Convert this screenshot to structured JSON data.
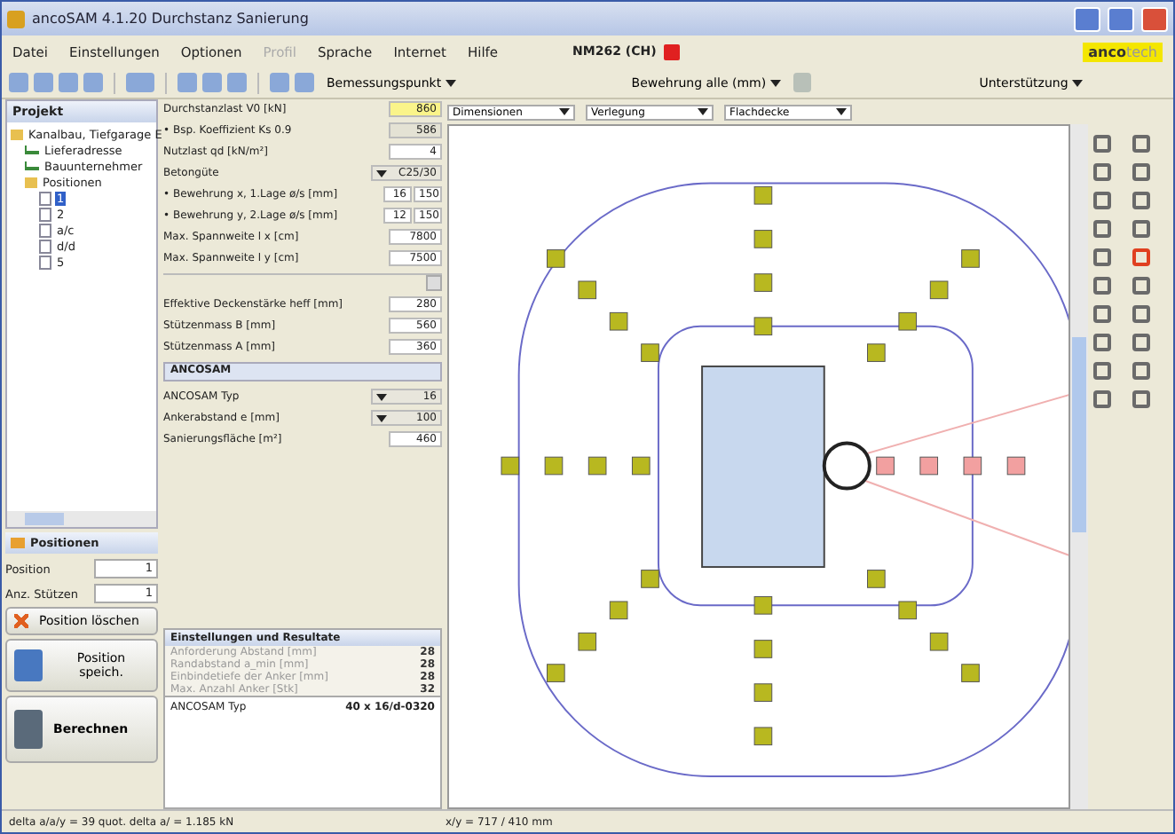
{
  "window": {
    "title": "ancoSAM 4.1.20 Durchstanz Sanierung"
  },
  "menu": [
    {
      "label": "Datei",
      "disabled": false
    },
    {
      "label": "Einstellungen",
      "disabled": false
    },
    {
      "label": "Optionen",
      "disabled": false
    },
    {
      "label": "Profil",
      "disabled": true
    },
    {
      "label": "Sprache",
      "disabled": false
    },
    {
      "label": "Internet",
      "disabled": false
    },
    {
      "label": "Hilfe",
      "disabled": false
    }
  ],
  "norm": "NM262 (CH)",
  "logo": {
    "part_1": "anco",
    "part_2": "tech"
  },
  "toolbar": {
    "dropdown_1": "Bemessungspunkt",
    "dropdown_2": "Bewehrung alle (mm)",
    "dropdown_3": "Unterstützung"
  },
  "tree": {
    "title": "Projekt",
    "items": [
      {
        "label": "Kanalbau, Tiefgarage E",
        "kind": "folder",
        "children": [
          {
            "label": "Lieferadresse",
            "kind": "check"
          },
          {
            "label": "Bauunternehmer",
            "kind": "check"
          },
          {
            "label": "Positionen",
            "kind": "folder",
            "children": [
              {
                "label": "1",
                "kind": "doc",
                "selected": true
              },
              {
                "label": "2",
                "kind": "doc",
                "selected": false
              },
              {
                "label": "a/c",
                "kind": "doc",
                "selected": false
              },
              {
                "label": "d/d",
                "kind": "doc",
                "selected": false
              },
              {
                "label": "5",
                "kind": "doc",
                "selected": false
              }
            ]
          }
        ]
      }
    ]
  },
  "position_panel": {
    "title": "Positionen",
    "fields": [
      {
        "label": "Position",
        "value": "1"
      },
      {
        "label": "Anz. Stützen",
        "value": "1"
      }
    ]
  },
  "buttons": [
    {
      "label": "Position löschen",
      "kind": "delete"
    },
    {
      "label": "Position speich.",
      "kind": "save"
    },
    {
      "label": "Berechnen",
      "kind": "calc"
    }
  ],
  "form": [
    {
      "kind": "input",
      "label": "Durchstanzlast V0 [kN]",
      "value": "860",
      "highlighted": true
    },
    {
      "kind": "readonly",
      "label": "• Bsp. Koeffizient Ks 0.9",
      "value": "586"
    },
    {
      "kind": "input",
      "label": "Nutzlast qd [kN/m²]",
      "value": "4",
      "highlighted": false
    },
    {
      "kind": "select",
      "label": "Betongüte",
      "value": "C25/30"
    },
    {
      "kind": "pair",
      "label": "• Bewehrung x, 1.Lage ø/s [mm]",
      "value": "16",
      "value_2": "150"
    },
    {
      "kind": "pair",
      "label": "• Bewehrung y, 2.Lage ø/s [mm]",
      "value": "12",
      "value_2": "150"
    },
    {
      "kind": "input",
      "label": "Max. Spannweite l x [cm]",
      "value": "7800",
      "highlighted": false
    },
    {
      "kind": "input",
      "label": "Max. Spannweite l y [cm]",
      "value": "7500",
      "highlighted": false
    },
    {
      "kind": "divider"
    },
    {
      "kind": "input",
      "label": "Effektive Deckenstärke heff [mm]",
      "value": "280",
      "highlighted": false
    },
    {
      "kind": "input",
      "label": "Stützenmass B [mm]",
      "value": "560",
      "highlighted": false
    },
    {
      "kind": "input",
      "label": "Stützenmass A [mm]",
      "value": "360",
      "highlighted": false
    },
    {
      "kind": "section",
      "label": "ANCOSAM"
    },
    {
      "kind": "select",
      "label": "ANCOSAM Typ",
      "value": "16"
    },
    {
      "kind": "select",
      "label": "Ankerabstand e [mm]",
      "value": "100"
    },
    {
      "kind": "input",
      "label": "Sanierungsfläche [m²]",
      "value": "460",
      "highlighted": false
    }
  ],
  "results": {
    "title": "Einstellungen und Resultate",
    "rows": [
      {
        "label": "Anforderung Abstand [mm]",
        "value": "28"
      },
      {
        "label": "Randabstand a_min [mm]",
        "value": "28"
      },
      {
        "label": "Einbindetiefe der Anker [mm]",
        "value": "28"
      },
      {
        "label": "Max. Anzahl Anker [Stk]",
        "value": "32"
      }
    ],
    "summary_label": "ANCOSAM Typ",
    "summary_value": "40 x 16/d-0320"
  },
  "canvas_dropdowns": [
    "Dimensionen",
    "Verlegung",
    "Flachdecke"
  ],
  "status_bar": {
    "left": "delta a/a/y = 39 quot.  delta a/ = 1.185 kN",
    "right": "x/y = 717 / 410 mm"
  }
}
